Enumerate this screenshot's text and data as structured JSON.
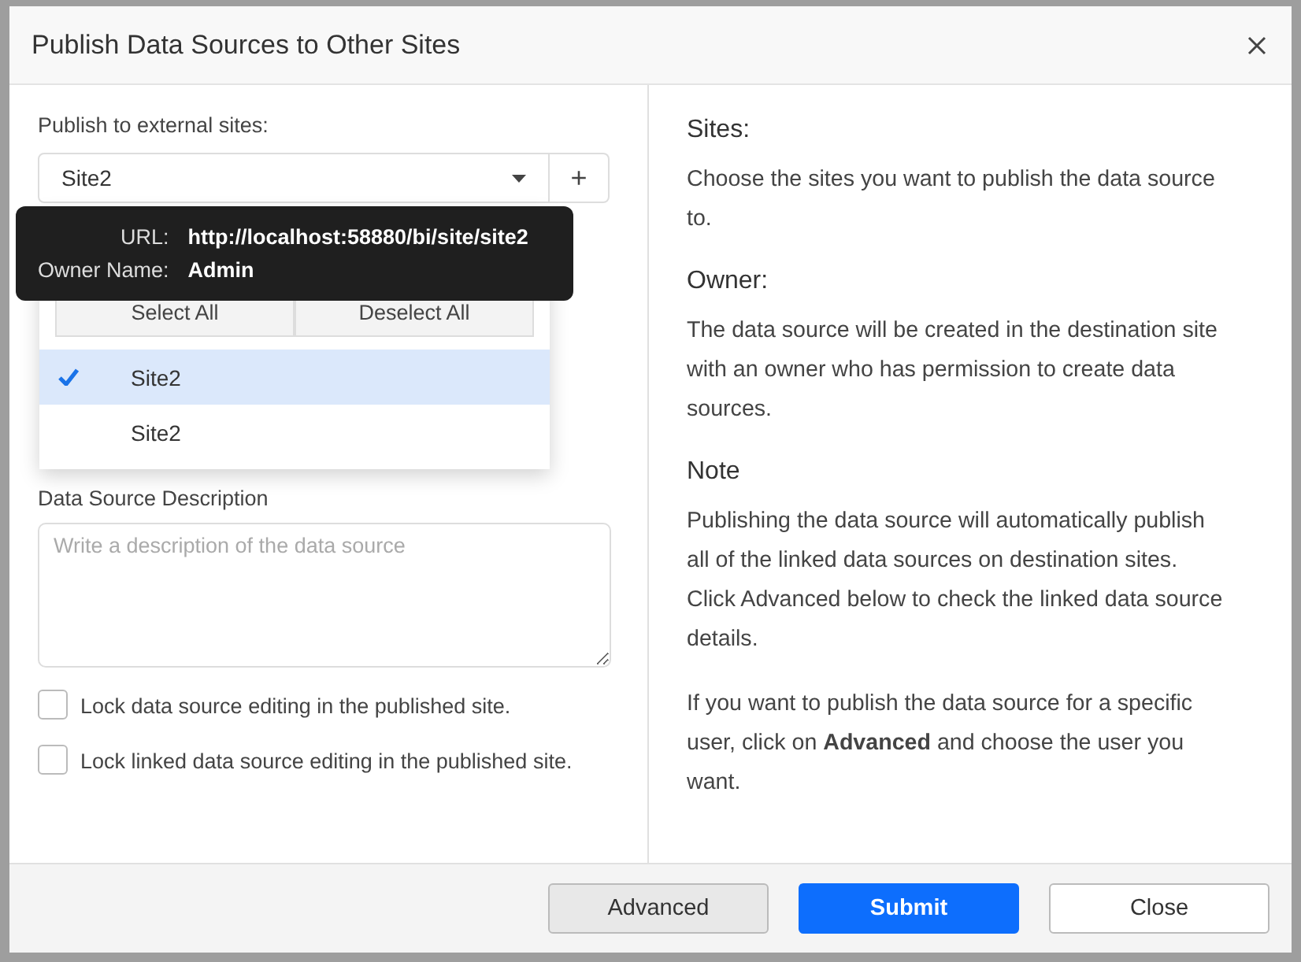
{
  "dialog": {
    "title": "Publish Data Sources to Other Sites"
  },
  "left": {
    "sites_label": "Publish to external sites:",
    "site_select": {
      "value": "Site2"
    },
    "add_button": "+",
    "dropdown": {
      "select_all": "Select All",
      "deselect_all": "Deselect All",
      "items": [
        {
          "label": "Site2",
          "selected": true
        },
        {
          "label": "Site2",
          "selected": false
        }
      ]
    },
    "tooltip": {
      "url_label": "URL:",
      "url": "http://localhost:58880/bi/site/site2",
      "owner_label": "Owner Name:",
      "owner": "Admin"
    },
    "description_label": "Data Source Description",
    "description": {
      "placeholder": "Write a description of the data source"
    },
    "checkboxes": [
      {
        "label": "Lock data source editing in the published site.",
        "checked": false
      },
      {
        "label": "Lock linked data source editing in the published site.",
        "checked": false
      }
    ]
  },
  "right": {
    "sections": [
      {
        "heading": "Sites:",
        "paragraphs": [
          "Choose the sites you want to publish the data source to."
        ]
      },
      {
        "heading": "Owner:",
        "paragraphs": [
          "The data source will be created in the destination site with an owner who has permission to create data sources."
        ]
      },
      {
        "heading": "Note",
        "paragraphs": [
          "Publishing the data source will automatically publish all of the linked data sources on destination sites. Click Advanced below to check the linked data source details.",
          "If you want to publish the data source for a specific user, click on **Advanced** and choose the user you want."
        ]
      }
    ]
  },
  "footer": {
    "buttons": [
      {
        "label": "Advanced",
        "kind": "secondary"
      },
      {
        "label": "Submit",
        "kind": "primary"
      },
      {
        "label": "Close",
        "kind": "outline"
      }
    ]
  }
}
